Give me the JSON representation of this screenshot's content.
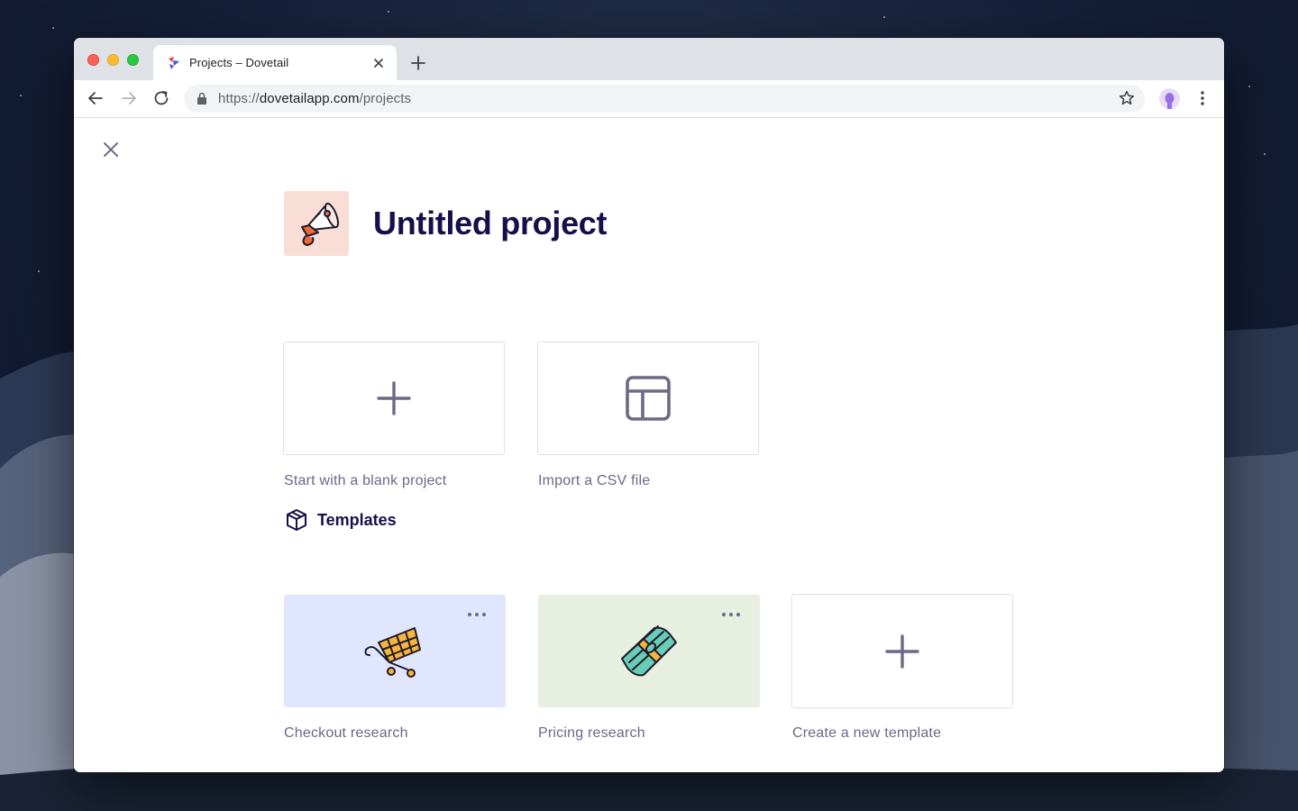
{
  "browser": {
    "tab_title": "Projects – Dovetail",
    "url_scheme": "https://",
    "url_host": "dovetailapp.com",
    "url_path": "/projects"
  },
  "project": {
    "title": "Untitled project",
    "icon": "megaphone-icon"
  },
  "actions": [
    {
      "label": "Start with a blank project",
      "icon": "plus-icon"
    },
    {
      "label": "Import a CSV file",
      "icon": "table-icon"
    }
  ],
  "templates": {
    "heading": "Templates",
    "icon": "box-icon",
    "items": [
      {
        "label": "Checkout research",
        "icon": "shopping-cart-icon",
        "background": "#dfe6fd"
      },
      {
        "label": "Pricing research",
        "icon": "money-stack-icon",
        "background": "#e6efe0"
      },
      {
        "label": "Create a new template",
        "icon": "plus-icon"
      }
    ]
  },
  "colors": {
    "title": "#16104a",
    "muted_text": "#6b6887",
    "icon_stroke": "#6d6987",
    "project_icon_bg": "#f9ded6"
  }
}
